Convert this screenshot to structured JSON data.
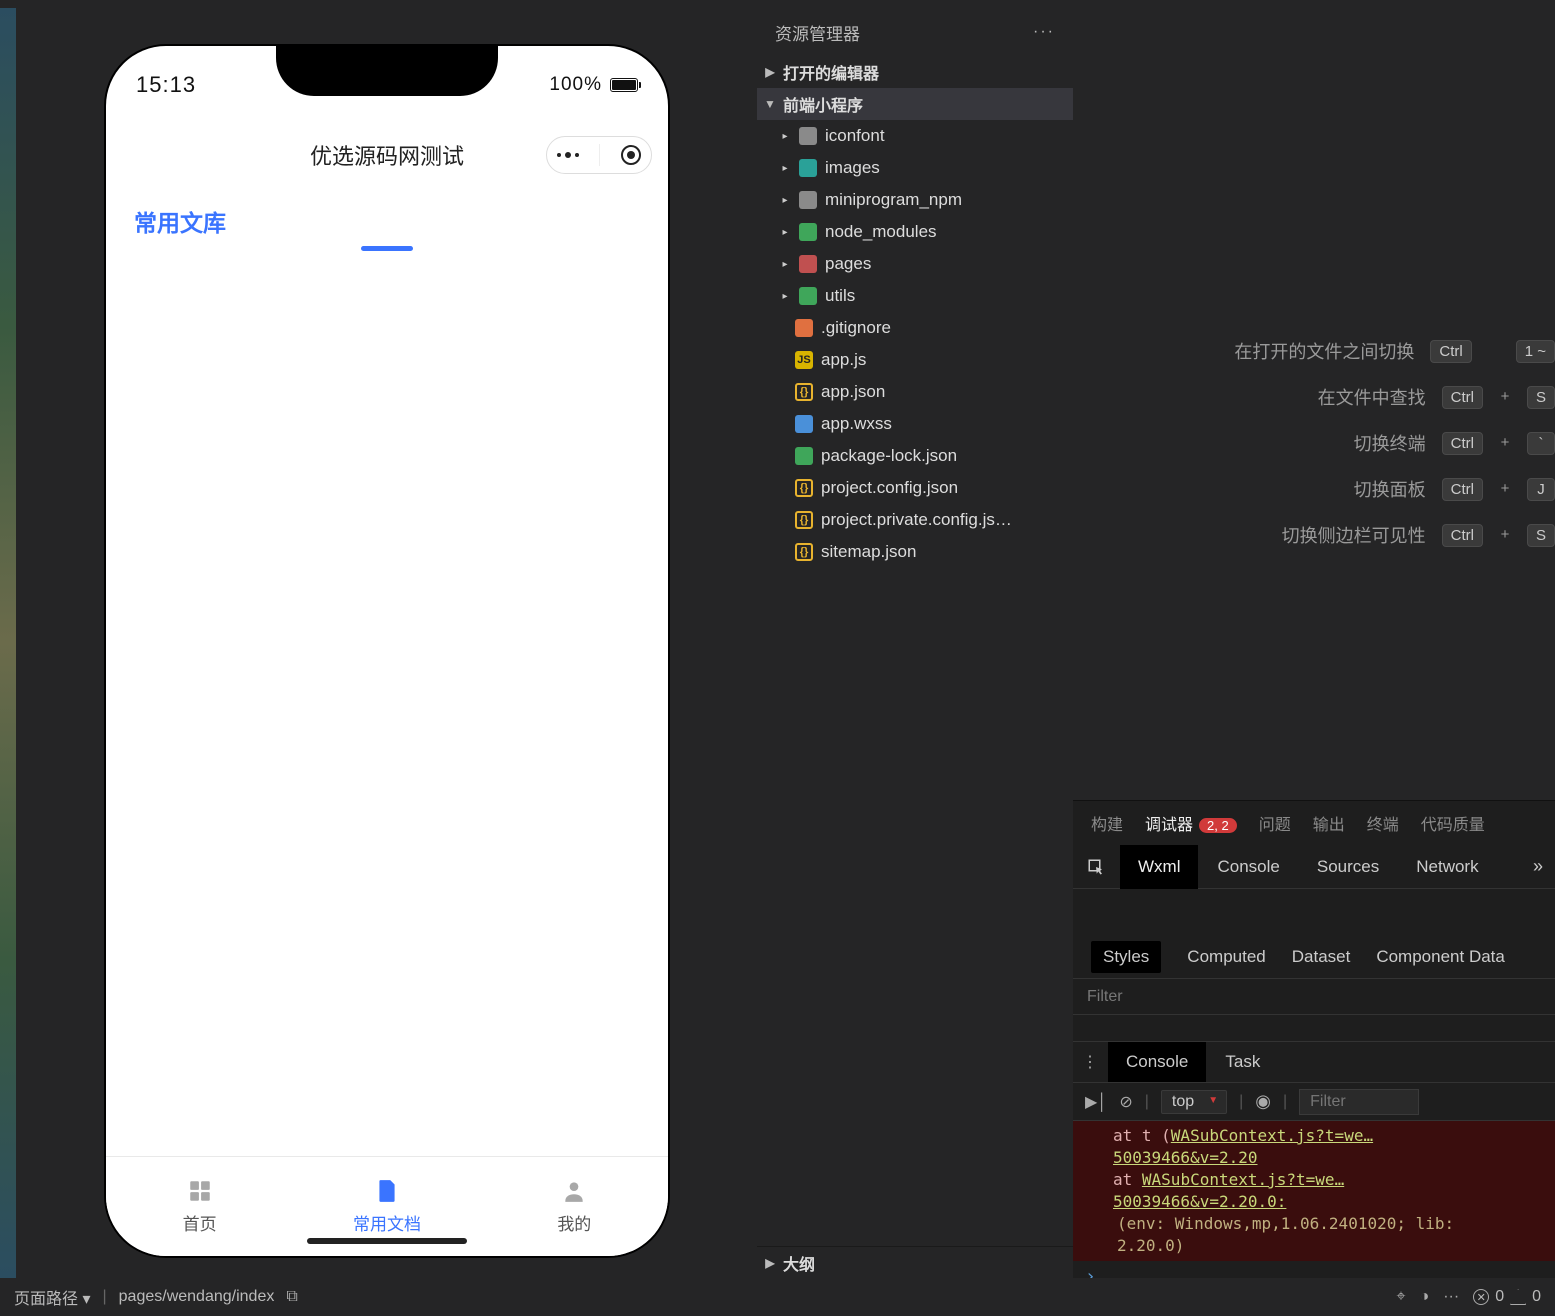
{
  "simulator": {
    "status_time": "15:13",
    "battery_percent": "100%",
    "app_title": "优选源码网测试",
    "active_tab": "常用文库",
    "tabbar": [
      {
        "label": "首页",
        "active": false
      },
      {
        "label": "常用文档",
        "active": true
      },
      {
        "label": "我的",
        "active": false
      }
    ]
  },
  "explorer": {
    "title": "资源管理器",
    "sections": {
      "open_editors": "打开的编辑器",
      "project": "前端小程序",
      "outline": "大纲"
    },
    "folders": [
      {
        "name": "iconfont",
        "icon": "folder"
      },
      {
        "name": "images",
        "icon": "folder-teal"
      },
      {
        "name": "miniprogram_npm",
        "icon": "folder"
      },
      {
        "name": "node_modules",
        "icon": "folder-green"
      },
      {
        "name": "pages",
        "icon": "folder-red"
      },
      {
        "name": "utils",
        "icon": "folder-green"
      }
    ],
    "files": [
      {
        "name": ".gitignore",
        "icon": "git"
      },
      {
        "name": "app.js",
        "icon": "js"
      },
      {
        "name": "app.json",
        "icon": "json"
      },
      {
        "name": "app.wxss",
        "icon": "wxss"
      },
      {
        "name": "package-lock.json",
        "icon": "npm"
      },
      {
        "name": "project.config.json",
        "icon": "json"
      },
      {
        "name": "project.private.config.js…",
        "icon": "json"
      },
      {
        "name": "sitemap.json",
        "icon": "json"
      }
    ]
  },
  "shortcuts": [
    {
      "label": "在打开的文件之间切换",
      "keys": [
        "Ctrl",
        "",
        "1 ~"
      ]
    },
    {
      "label": "在文件中查找",
      "keys": [
        "Ctrl",
        "+",
        "S"
      ]
    },
    {
      "label": "切换终端",
      "keys": [
        "Ctrl",
        "+",
        "`"
      ]
    },
    {
      "label": "切换面板",
      "keys": [
        "Ctrl",
        "+",
        "J"
      ]
    },
    {
      "label": "切换侧边栏可见性",
      "keys": [
        "Ctrl",
        "+",
        "S"
      ]
    }
  ],
  "bottom_panel": {
    "tabs": [
      {
        "label": "构建",
        "active": false
      },
      {
        "label": "调试器",
        "active": true,
        "badge": "2, 2"
      },
      {
        "label": "问题",
        "active": false
      },
      {
        "label": "输出",
        "active": false
      },
      {
        "label": "终端",
        "active": false
      },
      {
        "label": "代码质量",
        "active": false
      }
    ],
    "dbg_tabs": [
      "Wxml",
      "Console",
      "Sources",
      "Network"
    ],
    "dbg_active": "Wxml",
    "styles_tabs": [
      "Styles",
      "Computed",
      "Dataset",
      "Component Data"
    ],
    "styles_active": "Styles",
    "filter_placeholder": "Filter",
    "console_tabs": [
      "Console",
      "Task"
    ],
    "console_active": "Console",
    "console_scope": "top",
    "console_filter_placeholder": "Filter",
    "console_output": {
      "line1_prefix": "at t (",
      "line1_link": "WASubContext.js?t=we…50039466&v=2.20",
      "line2_prefix": "at ",
      "line2_link": "WASubContext.js?t=we…50039466&v=2.20.0:",
      "env": "(env: Windows,mp,1.06.2401020; lib: 2.20.0)"
    }
  },
  "statusbar": {
    "page_path_label": "页面路径",
    "page_path_value": "pages/wendang/index",
    "errors": "0",
    "warnings": "0"
  }
}
